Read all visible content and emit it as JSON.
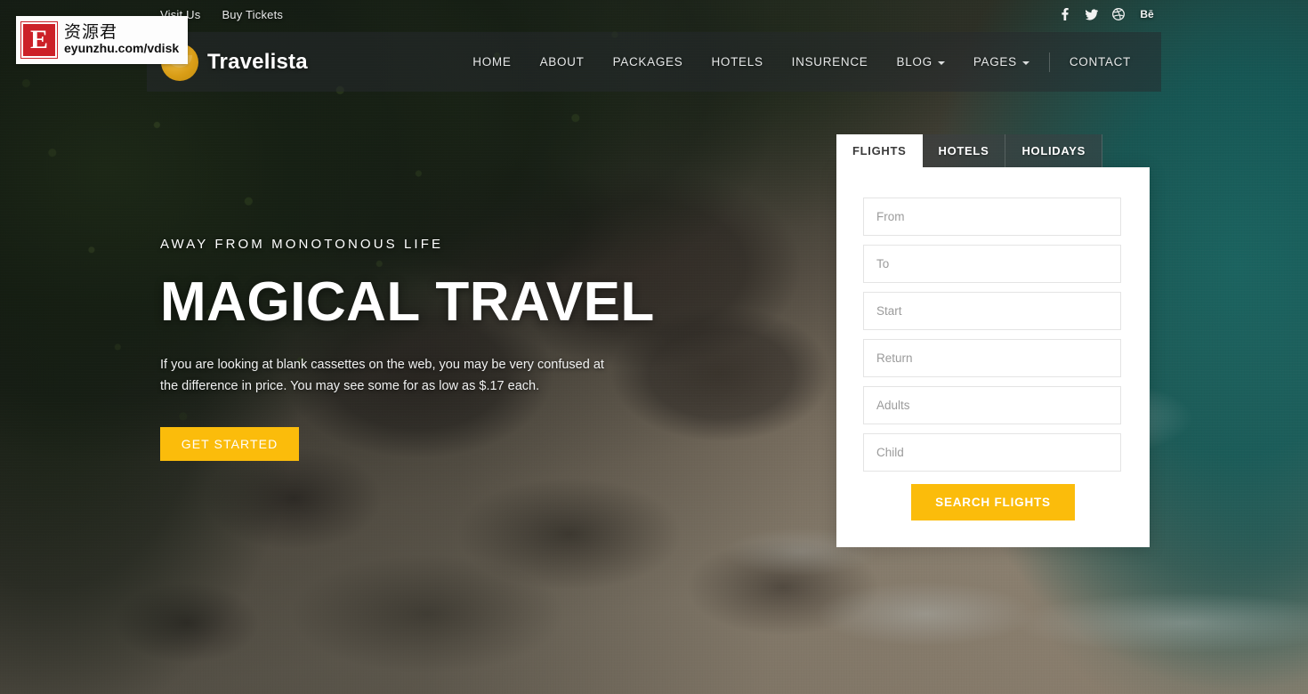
{
  "topbar": {
    "links": [
      {
        "label": "Visit Us"
      },
      {
        "label": "Buy Tickets"
      }
    ],
    "social": [
      {
        "name": "facebook-icon",
        "label": "f"
      },
      {
        "name": "twitter-icon",
        "label": ""
      },
      {
        "name": "dribbble-icon",
        "label": ""
      },
      {
        "name": "behance-icon",
        "label": "Bē"
      }
    ]
  },
  "brand": {
    "name": "Travelista",
    "logo_color": "#d99d16"
  },
  "nav": {
    "items": [
      {
        "label": "HOME",
        "has_dropdown": false
      },
      {
        "label": "ABOUT",
        "has_dropdown": false
      },
      {
        "label": "PACKAGES",
        "has_dropdown": false
      },
      {
        "label": "HOTELS",
        "has_dropdown": false
      },
      {
        "label": "INSURENCE",
        "has_dropdown": false
      },
      {
        "label": "BLOG",
        "has_dropdown": true
      },
      {
        "label": "PAGES",
        "has_dropdown": true
      },
      {
        "label": "CONTACT",
        "has_dropdown": false
      }
    ]
  },
  "hero": {
    "eyebrow": "AWAY FROM MONOTONOUS LIFE",
    "headline": "MAGICAL TRAVEL",
    "paragraph": "If you are looking at blank cassettes on the web, you may be very confused at the difference in price. You may see some for as low as $.17 each.",
    "cta_label": "GET STARTED",
    "cta_color": "#fbbc0b"
  },
  "booking": {
    "tabs": [
      {
        "label": "FLIGHTS",
        "active": true
      },
      {
        "label": "HOTELS",
        "active": false
      },
      {
        "label": "HOLIDAYS",
        "active": false
      }
    ],
    "fields": [
      {
        "name": "from-field",
        "placeholder": "From",
        "value": ""
      },
      {
        "name": "to-field",
        "placeholder": "To",
        "value": ""
      },
      {
        "name": "start-field",
        "placeholder": "Start",
        "value": ""
      },
      {
        "name": "return-field",
        "placeholder": "Return",
        "value": ""
      },
      {
        "name": "adults-field",
        "placeholder": "Adults",
        "value": ""
      },
      {
        "name": "child-field",
        "placeholder": "Child",
        "value": ""
      }
    ],
    "submit_label": "SEARCH FLIGHTS",
    "submit_color": "#fbbc0b"
  },
  "watermark": {
    "logo_letter": "E",
    "cn_text": "资源君",
    "url_text": "eyunzhu.com/vdisk",
    "logo_color": "#cc2128"
  }
}
